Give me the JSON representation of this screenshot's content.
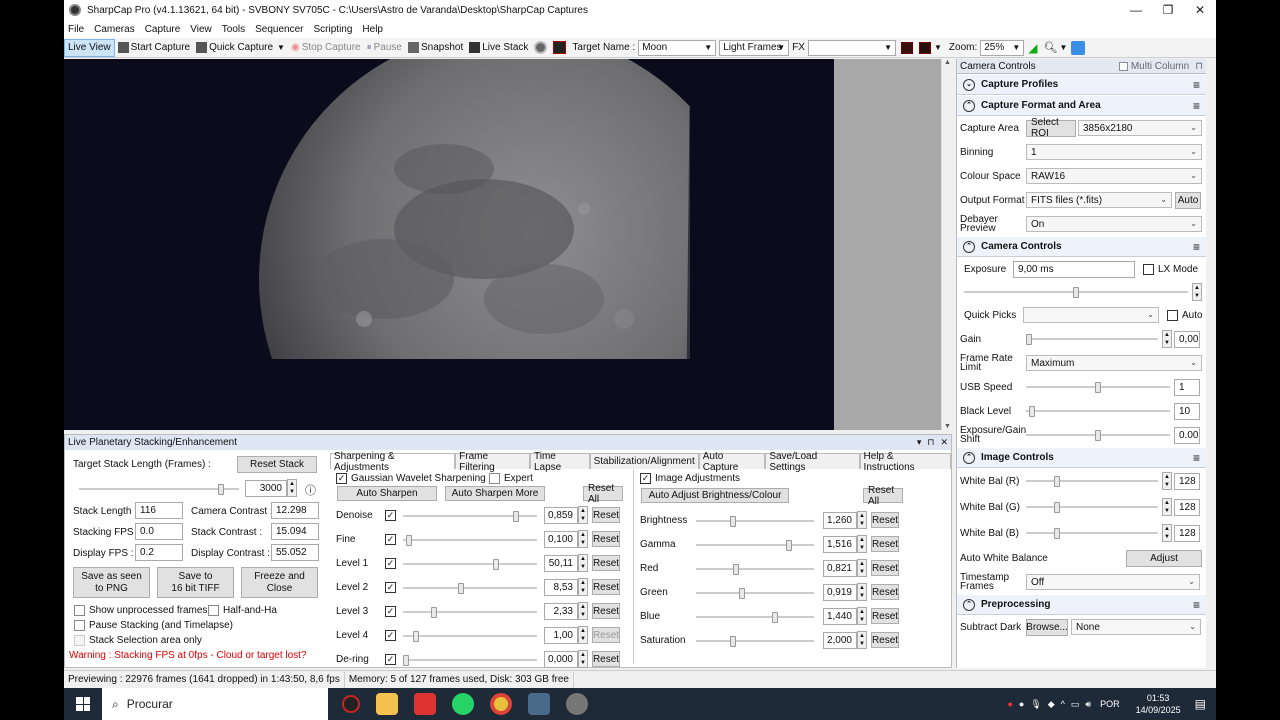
{
  "window": {
    "title": "SharpCap Pro (v4.1.13621, 64 bit) - SVBONY SV705C - C:\\Users\\Astro de Varanda\\Desktop\\SharpCap Captures"
  },
  "menu": [
    "File",
    "Cameras",
    "Capture",
    "View",
    "Tools",
    "Sequencer",
    "Scripting",
    "Help"
  ],
  "toolbar": {
    "live_view": "Live View",
    "start_capture": "Start Capture",
    "quick_capture": "Quick Capture",
    "stop_capture": "Stop Capture",
    "pause": "Pause",
    "snapshot": "Snapshot",
    "live_stack": "Live Stack",
    "target_name_label": "Target Name :",
    "target_name": "Moon",
    "frame_type": "Light Frames",
    "fx_label": "FX",
    "zoom_label": "Zoom:",
    "zoom": "25%"
  },
  "camera_controls": {
    "header": "Camera Controls",
    "multi_column": "Multi Column",
    "capture_profiles": "Capture Profiles",
    "capture_format_section": "Capture Format and Area",
    "capture_area_label": "Capture Area",
    "select_roi": "Select ROI",
    "capture_area": "3856x2180",
    "binning_label": "Binning",
    "binning": "1",
    "colour_space_label": "Colour Space",
    "colour_space": "RAW16",
    "output_format_label": "Output Format",
    "output_format": "FITS files (*.fits)",
    "auto": "Auto",
    "debayer_label": "Debayer Preview",
    "debayer": "On",
    "camera_controls_section": "Camera Controls",
    "exposure_label": "Exposure",
    "exposure": "9,00 ms",
    "lx_mode": "LX Mode",
    "exposure_level": 0.5,
    "quick_picks_label": "Quick Picks",
    "auto2": "Auto",
    "gain_label": "Gain",
    "gain": "0,00",
    "gain_level": 0.0,
    "frame_rate_label": "Frame Rate Limit",
    "frame_rate": "Maximum",
    "usb_speed_label": "USB Speed",
    "usb_speed": "1",
    "usb_level": 0.5,
    "black_level_label": "Black Level",
    "black_level": "10",
    "black_level_level": 0.02,
    "exposure_gain_shift_label": "Exposure/Gain Shift",
    "exposure_gain_shift": "0.00",
    "egs_level": 0.5,
    "image_controls_section": "Image Controls",
    "wb_r_label": "White Bal (R)",
    "wb_r": "128",
    "wb_g_label": "White Bal (G)",
    "wb_g": "128",
    "wb_b_label": "White Bal (B)",
    "wb_b": "128",
    "wb_level": 0.22,
    "auto_wb_label": "Auto White Balance",
    "adjust": "Adjust",
    "timestamp_label": "Timestamp Frames",
    "timestamp": "Off",
    "preprocessing_section": "Preprocessing",
    "subtract_dark_label": "Subtract Dark",
    "browse": "Browse...",
    "subtract_dark": "None"
  },
  "stacking": {
    "header": "Live Planetary Stacking/Enhancement",
    "target_stack_label": "Target Stack Length (Frames) :",
    "reset_stack": "Reset Stack",
    "target_stack_value": "3000",
    "target_stack_level": 0.9,
    "stack_length_label": "Stack Length :",
    "stack_length": "116",
    "camera_contrast_label": "Camera Contrast :",
    "camera_contrast": "12.298",
    "stacking_fps_label": "Stacking FPS :",
    "stacking_fps": "0.0",
    "stack_contrast_label": "Stack Contrast :",
    "stack_contrast": "15.094",
    "display_fps_label": "Display FPS :",
    "display_fps": "0.2",
    "display_contrast_label": "Display Contrast :",
    "display_contrast": "55.052",
    "save_png_1": "Save as seen",
    "save_png_2": "to PNG",
    "save_tiff_1": "Save to",
    "save_tiff_2": "16 bit TIFF",
    "freeze_1": "Freeze and",
    "freeze_2": "Close",
    "show_unprocessed": "Show unprocessed frames",
    "half_and_half": "Half-and-Ha",
    "pause_stacking": "Pause Stacking (and Timelapse)",
    "stack_selection": "Stack Selection area only",
    "warning": "Warning : Stacking FPS at 0fps - Cloud or target lost?"
  },
  "tabs": [
    "Sharpening & Adjustments",
    "Frame Filtering",
    "Time Lapse",
    "Stabilization/Alignment",
    "Auto Capture",
    "Save/Load Settings",
    "Help & Instructions"
  ],
  "sharpening": {
    "gaussian": "Gaussian Wavelet Sharpening",
    "expert": "Expert",
    "auto_sharpen": "Auto Sharpen",
    "auto_sharpen_more": "Auto Sharpen More",
    "reset_all": "Reset All",
    "reset": "Reset",
    "rows": [
      {
        "label": "Denoise",
        "value": "0,859",
        "level": 0.86
      },
      {
        "label": "Fine",
        "value": "0,100",
        "level": 0.02
      },
      {
        "label": "Level 1",
        "value": "50,11",
        "level": 0.7
      },
      {
        "label": "Level 2",
        "value": "8,53",
        "level": 0.43
      },
      {
        "label": "Level 3",
        "value": "2,33",
        "level": 0.22
      },
      {
        "label": "Level 4",
        "value": "1,00",
        "level": 0.08
      },
      {
        "label": "De-ring",
        "value": "0,000",
        "level": 0.0
      }
    ]
  },
  "adjustments": {
    "image_adjustments": "Image Adjustments",
    "auto_adjust": "Auto Adjust Brightness/Colour",
    "reset_all": "Reset All",
    "reset": "Reset",
    "rows": [
      {
        "label": "Brightness",
        "value": "1,260",
        "level": 0.3
      },
      {
        "label": "Gamma",
        "value": "1,516",
        "level": 0.8
      },
      {
        "label": "Red",
        "value": "0,821",
        "level": 0.33
      },
      {
        "label": "Green",
        "value": "0,919",
        "level": 0.38
      },
      {
        "label": "Blue",
        "value": "1,440",
        "level": 0.68
      },
      {
        "label": "Saturation",
        "value": "2,000",
        "level": 0.3
      }
    ]
  },
  "status": {
    "previewing": "Previewing : 22976 frames (1641 dropped) in 1:43:50, 8,6 fps",
    "memory": "Memory: 5 of 127 frames used, Disk: 303 GB free"
  },
  "taskbar": {
    "search": "Procurar",
    "lang": "POR",
    "time": "01:53",
    "date": "14/09/2025"
  }
}
